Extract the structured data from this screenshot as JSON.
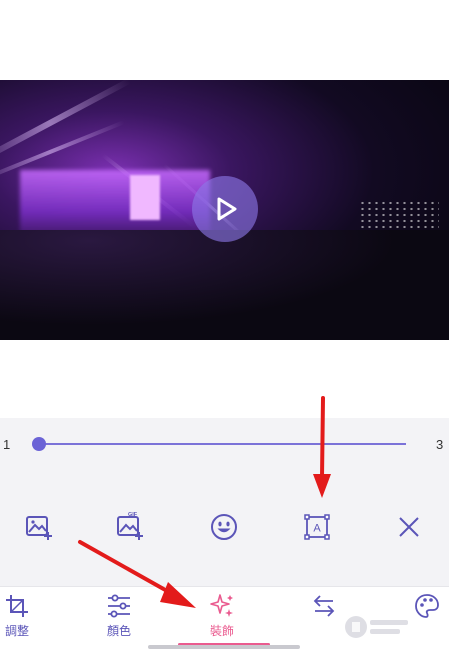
{
  "slider": {
    "min_label": "1",
    "max_label": "3",
    "value": 1
  },
  "video": {
    "play_icon": "play-icon"
  },
  "toolbar": {
    "icons": [
      "image-add-icon",
      "gif-add-icon",
      "sticker-icon",
      "text-frame-icon",
      "close-icon"
    ],
    "gif_text": "GIF",
    "text_frame_letter": "A"
  },
  "nav": {
    "items": [
      {
        "label": "調整",
        "icon": "crop-icon"
      },
      {
        "label": "顏色",
        "icon": "sliders-icon"
      },
      {
        "label": "裝飾",
        "icon": "sparkle-icon",
        "active": true
      },
      {
        "label": "",
        "icon": "swap-arrows-icon"
      },
      {
        "label": "",
        "icon": "palette-icon"
      }
    ]
  },
  "colors": {
    "accent": "#6b63d6",
    "active": "#ea5b8f",
    "annotation_arrow": "#e31b1b"
  }
}
